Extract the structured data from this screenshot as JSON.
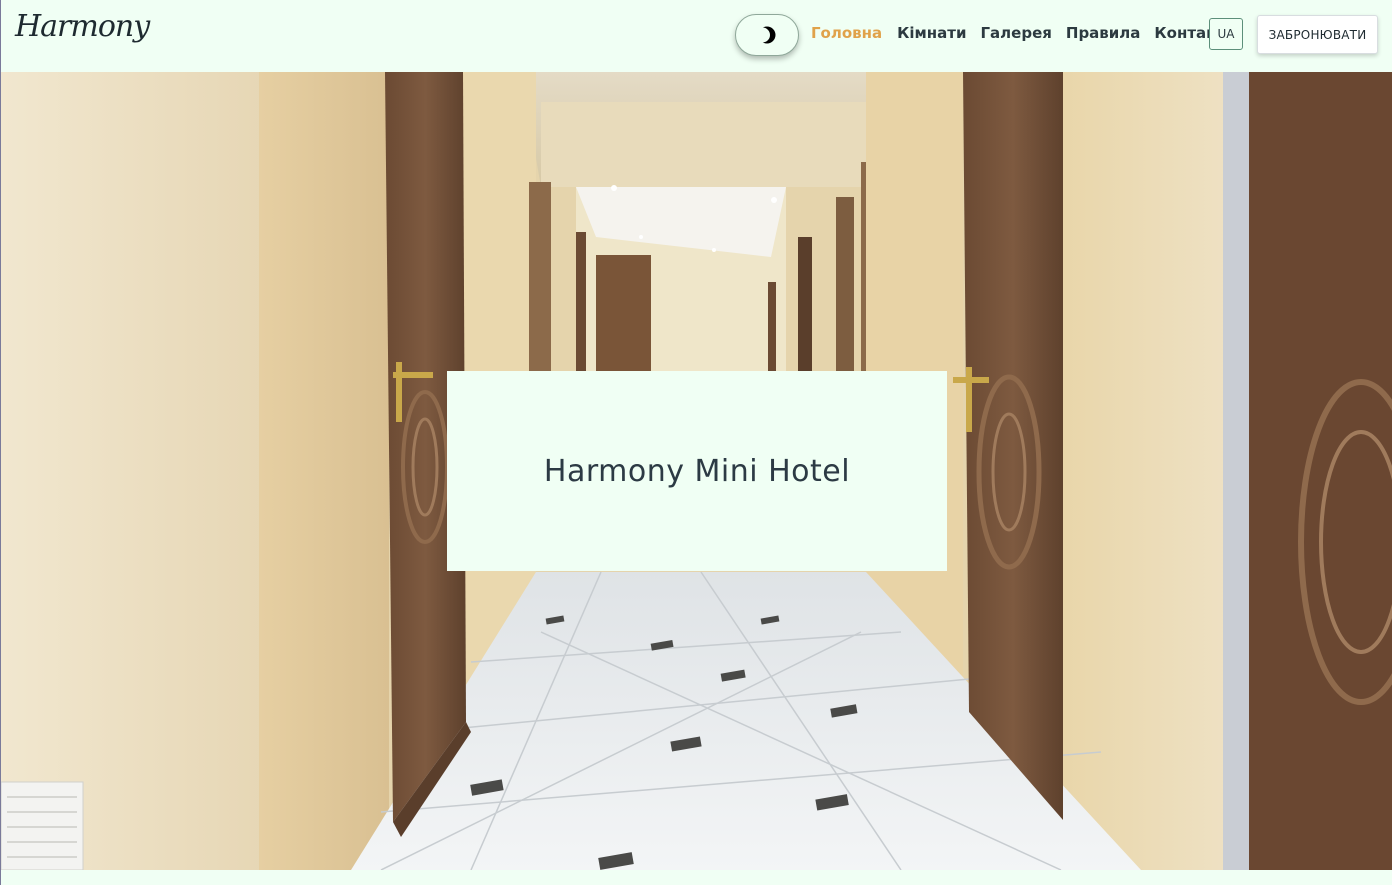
{
  "header": {
    "logo_text": "Harmony",
    "theme_toggle_icon": "moon-icon",
    "nav": [
      {
        "label": "Головна",
        "active": true
      },
      {
        "label": "Кімнати",
        "active": false
      },
      {
        "label": "Галерея",
        "active": false
      },
      {
        "label": "Правила",
        "active": false
      },
      {
        "label": "Контакти",
        "active": false
      }
    ],
    "language_label": "UA",
    "book_label": "ЗАБРОНЮВАТИ"
  },
  "hero": {
    "title": "Harmony Mini Hotel",
    "image": "hotel-corridor-photo"
  },
  "colors": {
    "background": "#f0fff4",
    "accent": "#e0a24a",
    "text": "#2c3a40"
  }
}
